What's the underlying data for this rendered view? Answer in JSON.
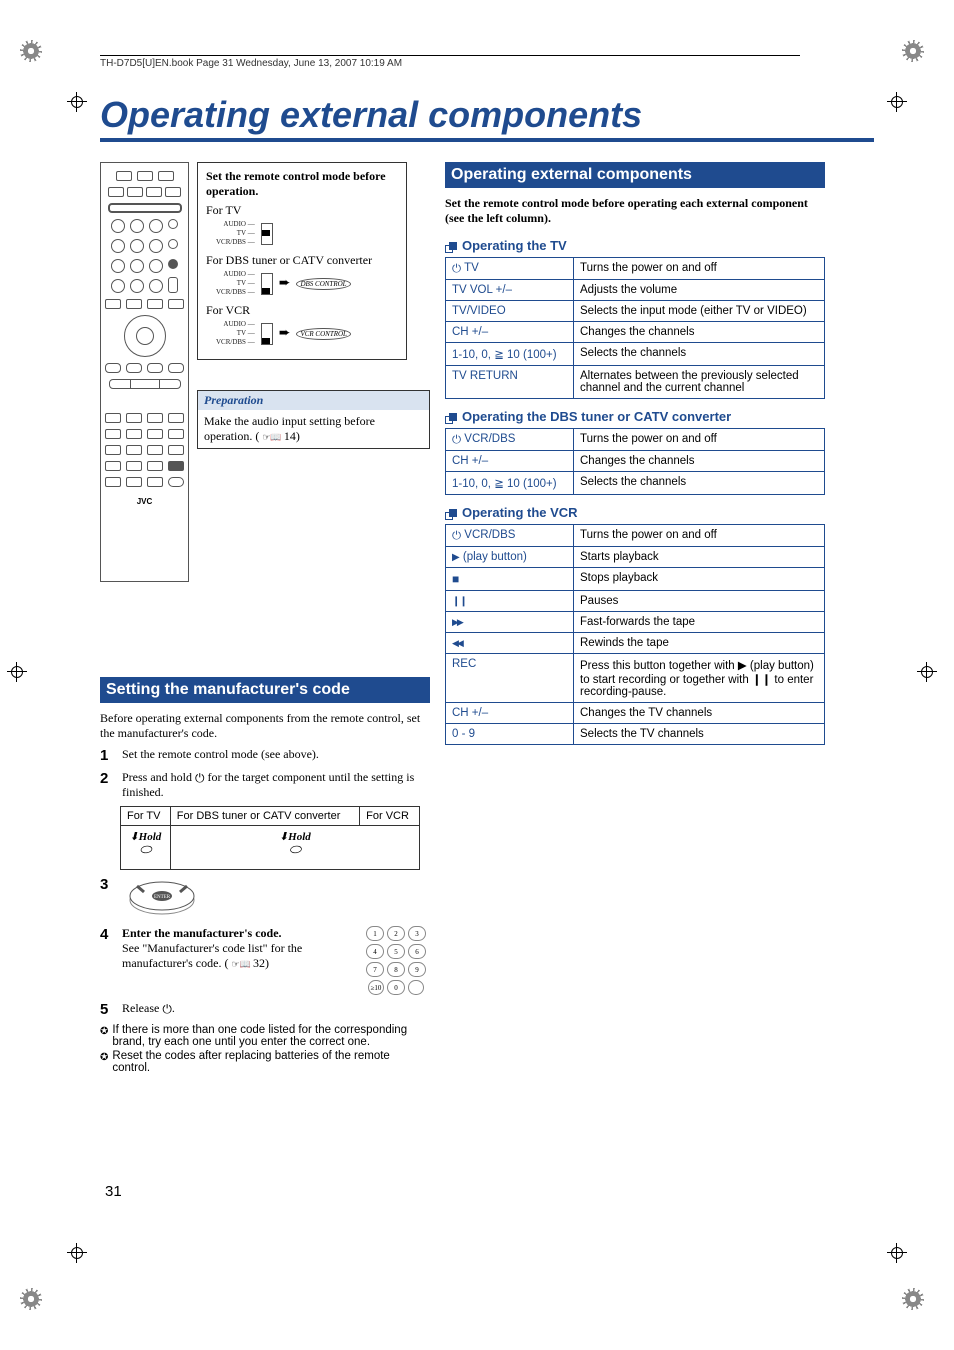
{
  "header_info": "TH-D7D5[U]EN.book  Page 31  Wednesday, June 13, 2007  10:19 AM",
  "main_title": "Operating external components",
  "remote_brand": "JVC",
  "remote_switch_labels": "AUDIO\nTV\nVCR/DBS",
  "instr_box": {
    "intro": "Set the remote control mode before operation.",
    "for_tv": "For TV",
    "for_dbs": "For DBS tuner or CATV converter",
    "for_vcr": "For VCR",
    "dbs_label": "DBS CONTROL",
    "vcr_label": "VCR CONTROL"
  },
  "preparation": {
    "title": "Preparation",
    "body": "Make the audio input setting before operation. (",
    "ref": "14)"
  },
  "left_section_title": "Setting the manufacturer's code",
  "left_intro": "Before operating external components from the remote control, set the manufacturer's code.",
  "steps": {
    "s1": "Set the remote control mode (see above).",
    "s2_a": "Press and hold ",
    "s2_b": " for the target component until the setting is finished.",
    "s4_a": "Enter the manufacturer's code.",
    "s4_b": "See \"Manufacturer's code list\" for the manufacturer's code. (",
    "s4_ref": "32)",
    "s5_a": "Release ",
    "s5_b": "."
  },
  "step_table": {
    "h1": "For TV",
    "h2": "For DBS tuner or CATV converter",
    "h3": "For VCR",
    "hold": "Hold"
  },
  "notes": {
    "n1": "If there is more than one code listed for the corresponding brand, try each one until you enter the correct one.",
    "n2": "Reset the codes after replacing batteries of the remote control."
  },
  "right_section_title": "Operating external components",
  "right_intro": "Set the remote control mode before operating each external component (see the left column).",
  "subheadings": {
    "tv": "Operating the TV",
    "dbs": "Operating the DBS tuner or CATV converter",
    "vcr": "Operating the VCR"
  },
  "tv_table": [
    {
      "k": " TV",
      "prefix": "power",
      "v": "Turns the power on and off"
    },
    {
      "k": "TV VOL +/–",
      "v": "Adjusts the volume"
    },
    {
      "k": "TV/VIDEO",
      "v": "Selects the input mode (either TV or VIDEO)"
    },
    {
      "k": "CH +/–",
      "v": "Changes the channels"
    },
    {
      "k": "1-10, 0, ≧ 10 (100+)",
      "v": "Selects the channels"
    },
    {
      "k": "TV RETURN",
      "v": "Alternates between the previously selected channel and the current channel"
    }
  ],
  "dbs_table": [
    {
      "k": " VCR/DBS",
      "prefix": "power",
      "v": "Turns the power on and off"
    },
    {
      "k": "CH +/–",
      "v": "Changes the channels"
    },
    {
      "k": "1-10, 0, ≧ 10 (100+)",
      "v": "Selects the channels"
    }
  ],
  "vcr_table": [
    {
      "k": " VCR/DBS",
      "prefix": "power",
      "v": "Turns the power on and off"
    },
    {
      "k": " (play button)",
      "prefix": "play",
      "v": "Starts playback"
    },
    {
      "k": "",
      "prefix": "stop",
      "v": "Stops playback"
    },
    {
      "k": "",
      "prefix": "pause",
      "v": "Pauses"
    },
    {
      "k": "",
      "prefix": "ff",
      "v": "Fast-forwards the tape"
    },
    {
      "k": "",
      "prefix": "rw",
      "v": "Rewinds the tape"
    },
    {
      "k": "REC",
      "v": "Press this button together with ▶ (play button) to start recording or together with ❙❙ to enter recording-pause."
    },
    {
      "k": "CH +/–",
      "v": "Changes the TV channels"
    },
    {
      "k": "0 - 9",
      "v": "Selects the TV channels"
    }
  ],
  "page_number": "31"
}
